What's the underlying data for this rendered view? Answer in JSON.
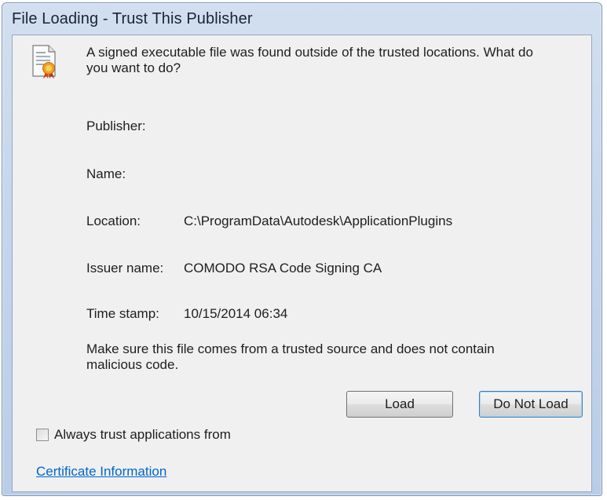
{
  "window": {
    "title": "File Loading - Trust This Publisher"
  },
  "icons": {
    "document": "signed-document-icon"
  },
  "message": "A signed executable file was found outside of the trusted locations.  What do you want to do?",
  "fields": [
    {
      "label": "Publisher:",
      "value": ""
    },
    {
      "label": "Name:",
      "value": ""
    },
    {
      "label": "Location:",
      "value": "C:\\ProgramData\\Autodesk\\ApplicationPlugins"
    },
    {
      "label": "Issuer name:",
      "value": "COMODO RSA Code Signing CA"
    },
    {
      "label": "Time stamp:",
      "value": "10/15/2014 06:34"
    }
  ],
  "warning": "Make sure this file comes from a trusted source and does not contain malicious code.",
  "buttons": {
    "load": "Load",
    "do_not_load": "Do Not Load"
  },
  "checkbox": {
    "label": "Always trust applications from",
    "checked": false
  },
  "link": "Certificate Information",
  "colors": {
    "link": "#0066cc",
    "title_bar": "#c4d5ec",
    "client_bg": "#f0f0f0"
  }
}
